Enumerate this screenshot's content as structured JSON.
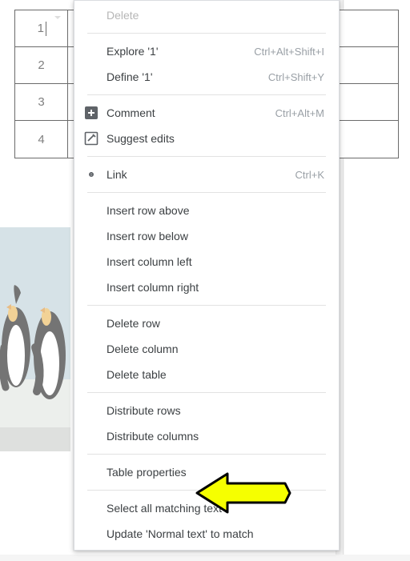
{
  "table": {
    "rows": [
      "1",
      "2",
      "3",
      "4"
    ]
  },
  "menu": {
    "delete": "Delete",
    "explore": "Explore '1'",
    "explore_sc": "Ctrl+Alt+Shift+I",
    "define": "Define '1'",
    "define_sc": "Ctrl+Shift+Y",
    "comment": "Comment",
    "comment_sc": "Ctrl+Alt+M",
    "suggest": "Suggest edits",
    "link": "Link",
    "link_sc": "Ctrl+K",
    "insert_row_above": "Insert row above",
    "insert_row_below": "Insert row below",
    "insert_col_left": "Insert column left",
    "insert_col_right": "Insert column right",
    "delete_row": "Delete row",
    "delete_col": "Delete column",
    "delete_table": "Delete table",
    "distribute_rows": "Distribute rows",
    "distribute_cols": "Distribute columns",
    "table_props": "Table properties",
    "select_matching": "Select all matching text",
    "update_normal": "Update 'Normal text' to match"
  }
}
